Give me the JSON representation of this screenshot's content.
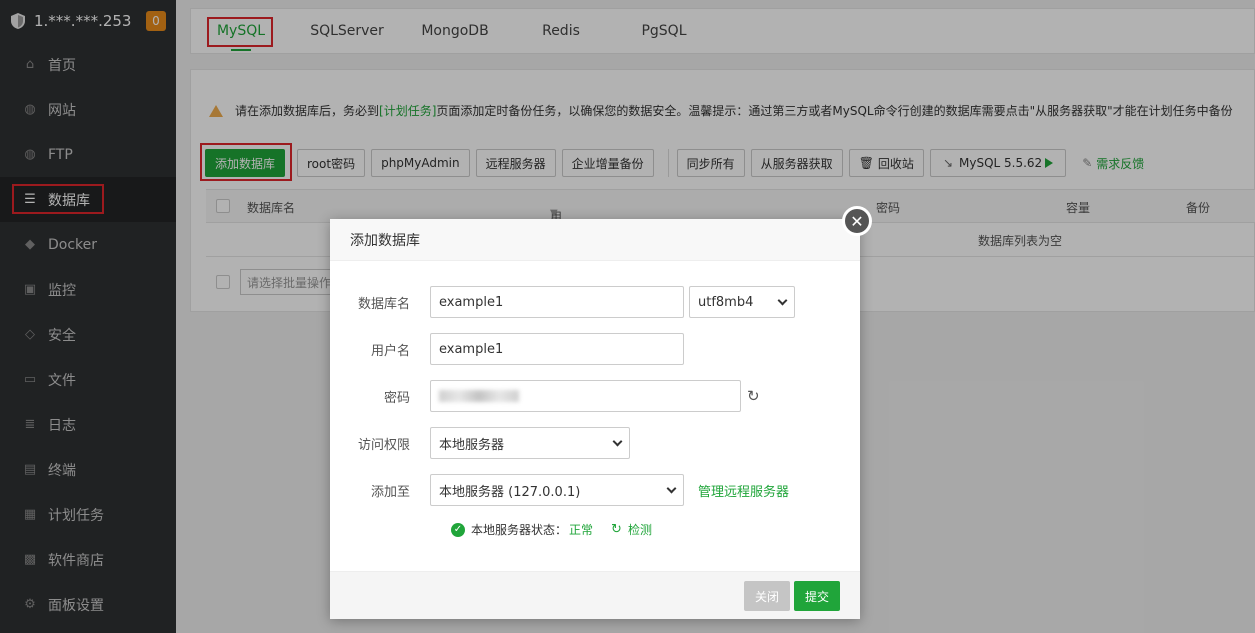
{
  "sidebar": {
    "ip": "1.***.***.253",
    "badge": "0",
    "items": [
      {
        "label": "首页",
        "icon": "home-icon"
      },
      {
        "label": "网站",
        "icon": "globe-icon"
      },
      {
        "label": "FTP",
        "icon": "ftp-globe-icon"
      },
      {
        "label": "数据库",
        "icon": "database-icon"
      },
      {
        "label": "Docker",
        "icon": "docker-icon"
      },
      {
        "label": "监控",
        "icon": "monitor-icon"
      },
      {
        "label": "安全",
        "icon": "shield-icon"
      },
      {
        "label": "文件",
        "icon": "folder-icon"
      },
      {
        "label": "日志",
        "icon": "log-icon"
      },
      {
        "label": "终端",
        "icon": "terminal-icon"
      },
      {
        "label": "计划任务",
        "icon": "calendar-icon"
      },
      {
        "label": "软件商店",
        "icon": "grid-icon"
      },
      {
        "label": "面板设置",
        "icon": "gear-icon"
      }
    ]
  },
  "tabs": [
    "MySQL",
    "SQLServer",
    "MongoDB",
    "Redis",
    "PgSQL"
  ],
  "notice": {
    "pre": "请在添加数据库后，务必到",
    "link": "[计划任务]",
    "post": "页面添加定时备份任务，以确保您的数据安全。温馨提示：通过第三方或者MySQL命令行创建的数据库需要点击\"从服务器获取\"才能在计划任务中备份"
  },
  "toolbar": {
    "add_db": "添加数据库",
    "root_pw": "root密码",
    "phpmyadmin": "phpMyAdmin",
    "remote_server": "远程服务器",
    "incremental_backup": "企业增量备份",
    "sync_all": "同步所有",
    "fetch_from_server": "从服务器获取",
    "recycle_bin": "回收站",
    "mysql_version": "MySQL 5.5.62",
    "feedback": "需求反馈"
  },
  "table": {
    "headers": [
      "数据库名",
      "用户名",
      "密码",
      "容量",
      "备份"
    ],
    "empty_text": "数据库列表为空",
    "batch_placeholder": "请选择批量操作"
  },
  "modal": {
    "title": "添加数据库",
    "db_name_label": "数据库名",
    "db_name_value": "example1",
    "charset_value": "utf8mb4",
    "username_label": "用户名",
    "username_value": "example1",
    "password_label": "密码",
    "access_label": "访问权限",
    "access_value": "本地服务器",
    "add_to_label": "添加至",
    "add_to_value": "本地服务器 (127.0.0.1)",
    "manage_remote": "管理远程服务器",
    "status_label": "本地服务器状态：",
    "status_value": "正常",
    "check_label": "检测",
    "close_button": "关闭",
    "submit_button": "提交"
  },
  "colors": {
    "accent": "#20a53a",
    "highlight": "#e0262b",
    "sidebar_bg": "#2f3133"
  }
}
